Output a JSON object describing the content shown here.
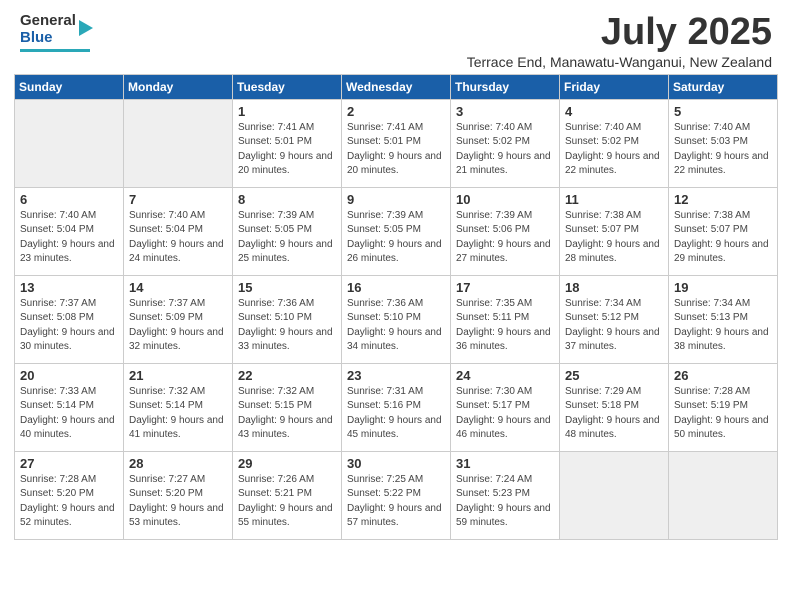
{
  "header": {
    "logo_line1": "General",
    "logo_line2": "Blue",
    "month_title": "July 2025",
    "subtitle": "Terrace End, Manawatu-Wanganui, New Zealand"
  },
  "days_of_week": [
    "Sunday",
    "Monday",
    "Tuesday",
    "Wednesday",
    "Thursday",
    "Friday",
    "Saturday"
  ],
  "weeks": [
    [
      {
        "num": "",
        "empty": true
      },
      {
        "num": "",
        "empty": true
      },
      {
        "num": "1",
        "sunrise": "7:41 AM",
        "sunset": "5:01 PM",
        "daylight": "9 hours and 20 minutes."
      },
      {
        "num": "2",
        "sunrise": "7:41 AM",
        "sunset": "5:01 PM",
        "daylight": "9 hours and 20 minutes."
      },
      {
        "num": "3",
        "sunrise": "7:40 AM",
        "sunset": "5:02 PM",
        "daylight": "9 hours and 21 minutes."
      },
      {
        "num": "4",
        "sunrise": "7:40 AM",
        "sunset": "5:02 PM",
        "daylight": "9 hours and 22 minutes."
      },
      {
        "num": "5",
        "sunrise": "7:40 AM",
        "sunset": "5:03 PM",
        "daylight": "9 hours and 22 minutes."
      }
    ],
    [
      {
        "num": "6",
        "sunrise": "7:40 AM",
        "sunset": "5:04 PM",
        "daylight": "9 hours and 23 minutes."
      },
      {
        "num": "7",
        "sunrise": "7:40 AM",
        "sunset": "5:04 PM",
        "daylight": "9 hours and 24 minutes."
      },
      {
        "num": "8",
        "sunrise": "7:39 AM",
        "sunset": "5:05 PM",
        "daylight": "9 hours and 25 minutes."
      },
      {
        "num": "9",
        "sunrise": "7:39 AM",
        "sunset": "5:05 PM",
        "daylight": "9 hours and 26 minutes."
      },
      {
        "num": "10",
        "sunrise": "7:39 AM",
        "sunset": "5:06 PM",
        "daylight": "9 hours and 27 minutes."
      },
      {
        "num": "11",
        "sunrise": "7:38 AM",
        "sunset": "5:07 PM",
        "daylight": "9 hours and 28 minutes."
      },
      {
        "num": "12",
        "sunrise": "7:38 AM",
        "sunset": "5:07 PM",
        "daylight": "9 hours and 29 minutes."
      }
    ],
    [
      {
        "num": "13",
        "sunrise": "7:37 AM",
        "sunset": "5:08 PM",
        "daylight": "9 hours and 30 minutes."
      },
      {
        "num": "14",
        "sunrise": "7:37 AM",
        "sunset": "5:09 PM",
        "daylight": "9 hours and 32 minutes."
      },
      {
        "num": "15",
        "sunrise": "7:36 AM",
        "sunset": "5:10 PM",
        "daylight": "9 hours and 33 minutes."
      },
      {
        "num": "16",
        "sunrise": "7:36 AM",
        "sunset": "5:10 PM",
        "daylight": "9 hours and 34 minutes."
      },
      {
        "num": "17",
        "sunrise": "7:35 AM",
        "sunset": "5:11 PM",
        "daylight": "9 hours and 36 minutes."
      },
      {
        "num": "18",
        "sunrise": "7:34 AM",
        "sunset": "5:12 PM",
        "daylight": "9 hours and 37 minutes."
      },
      {
        "num": "19",
        "sunrise": "7:34 AM",
        "sunset": "5:13 PM",
        "daylight": "9 hours and 38 minutes."
      }
    ],
    [
      {
        "num": "20",
        "sunrise": "7:33 AM",
        "sunset": "5:14 PM",
        "daylight": "9 hours and 40 minutes."
      },
      {
        "num": "21",
        "sunrise": "7:32 AM",
        "sunset": "5:14 PM",
        "daylight": "9 hours and 41 minutes."
      },
      {
        "num": "22",
        "sunrise": "7:32 AM",
        "sunset": "5:15 PM",
        "daylight": "9 hours and 43 minutes."
      },
      {
        "num": "23",
        "sunrise": "7:31 AM",
        "sunset": "5:16 PM",
        "daylight": "9 hours and 45 minutes."
      },
      {
        "num": "24",
        "sunrise": "7:30 AM",
        "sunset": "5:17 PM",
        "daylight": "9 hours and 46 minutes."
      },
      {
        "num": "25",
        "sunrise": "7:29 AM",
        "sunset": "5:18 PM",
        "daylight": "9 hours and 48 minutes."
      },
      {
        "num": "26",
        "sunrise": "7:28 AM",
        "sunset": "5:19 PM",
        "daylight": "9 hours and 50 minutes."
      }
    ],
    [
      {
        "num": "27",
        "sunrise": "7:28 AM",
        "sunset": "5:20 PM",
        "daylight": "9 hours and 52 minutes."
      },
      {
        "num": "28",
        "sunrise": "7:27 AM",
        "sunset": "5:20 PM",
        "daylight": "9 hours and 53 minutes."
      },
      {
        "num": "29",
        "sunrise": "7:26 AM",
        "sunset": "5:21 PM",
        "daylight": "9 hours and 55 minutes."
      },
      {
        "num": "30",
        "sunrise": "7:25 AM",
        "sunset": "5:22 PM",
        "daylight": "9 hours and 57 minutes."
      },
      {
        "num": "31",
        "sunrise": "7:24 AM",
        "sunset": "5:23 PM",
        "daylight": "9 hours and 59 minutes."
      },
      {
        "num": "",
        "empty": true
      },
      {
        "num": "",
        "empty": true
      }
    ]
  ]
}
